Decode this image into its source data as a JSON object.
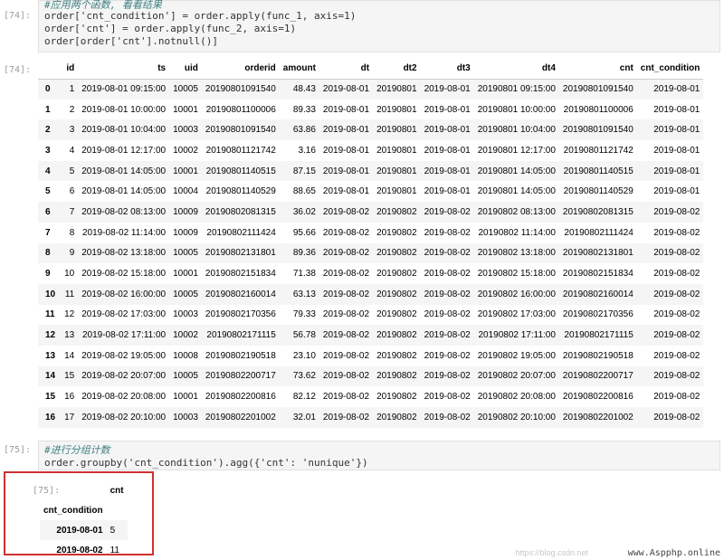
{
  "cell74": {
    "prompt": "[74]:",
    "code": [
      "#应用两个函数, 看看结果",
      "order['cnt_condition'] = order.apply(func_1, axis=1)",
      "order['cnt'] = order.apply(func_2, axis=1)",
      "order[order['cnt'].notnull()]"
    ],
    "out_prompt": "[74]:",
    "columns": [
      "",
      "id",
      "ts",
      "uid",
      "orderid",
      "amount",
      "dt",
      "dt2",
      "dt3",
      "dt4",
      "cnt",
      "cnt_condition"
    ],
    "rows": [
      [
        "0",
        "1",
        "2019-08-01 09:15:00",
        "10005",
        "20190801091540",
        "48.43",
        "2019-08-01",
        "20190801",
        "2019-08-01",
        "20190801 09:15:00",
        "20190801091540",
        "2019-08-01"
      ],
      [
        "1",
        "2",
        "2019-08-01 10:00:00",
        "10001",
        "20190801100006",
        "89.33",
        "2019-08-01",
        "20190801",
        "2019-08-01",
        "20190801 10:00:00",
        "20190801100006",
        "2019-08-01"
      ],
      [
        "2",
        "3",
        "2019-08-01 10:04:00",
        "10003",
        "20190801091540",
        "63.86",
        "2019-08-01",
        "20190801",
        "2019-08-01",
        "20190801 10:04:00",
        "20190801091540",
        "2019-08-01"
      ],
      [
        "3",
        "4",
        "2019-08-01 12:17:00",
        "10002",
        "20190801121742",
        "3.16",
        "2019-08-01",
        "20190801",
        "2019-08-01",
        "20190801 12:17:00",
        "20190801121742",
        "2019-08-01"
      ],
      [
        "4",
        "5",
        "2019-08-01 14:05:00",
        "10001",
        "20190801140515",
        "87.15",
        "2019-08-01",
        "20190801",
        "2019-08-01",
        "20190801 14:05:00",
        "20190801140515",
        "2019-08-01"
      ],
      [
        "5",
        "6",
        "2019-08-01 14:05:00",
        "10004",
        "20190801140529",
        "88.65",
        "2019-08-01",
        "20190801",
        "2019-08-01",
        "20190801 14:05:00",
        "20190801140529",
        "2019-08-01"
      ],
      [
        "6",
        "7",
        "2019-08-02 08:13:00",
        "10009",
        "20190802081315",
        "36.02",
        "2019-08-02",
        "20190802",
        "2019-08-02",
        "20190802 08:13:00",
        "20190802081315",
        "2019-08-02"
      ],
      [
        "7",
        "8",
        "2019-08-02 11:14:00",
        "10009",
        "20190802111424",
        "95.66",
        "2019-08-02",
        "20190802",
        "2019-08-02",
        "20190802 11:14:00",
        "20190802111424",
        "2019-08-02"
      ],
      [
        "8",
        "9",
        "2019-08-02 13:18:00",
        "10005",
        "20190802131801",
        "89.36",
        "2019-08-02",
        "20190802",
        "2019-08-02",
        "20190802 13:18:00",
        "20190802131801",
        "2019-08-02"
      ],
      [
        "9",
        "10",
        "2019-08-02 15:18:00",
        "10001",
        "20190802151834",
        "71.38",
        "2019-08-02",
        "20190802",
        "2019-08-02",
        "20190802 15:18:00",
        "20190802151834",
        "2019-08-02"
      ],
      [
        "10",
        "11",
        "2019-08-02 16:00:00",
        "10005",
        "20190802160014",
        "63.13",
        "2019-08-02",
        "20190802",
        "2019-08-02",
        "20190802 16:00:00",
        "20190802160014",
        "2019-08-02"
      ],
      [
        "11",
        "12",
        "2019-08-02 17:03:00",
        "10003",
        "20190802170356",
        "79.33",
        "2019-08-02",
        "20190802",
        "2019-08-02",
        "20190802 17:03:00",
        "20190802170356",
        "2019-08-02"
      ],
      [
        "12",
        "13",
        "2019-08-02 17:11:00",
        "10002",
        "20190802171115",
        "56.78",
        "2019-08-02",
        "20190802",
        "2019-08-02",
        "20190802 17:11:00",
        "20190802171115",
        "2019-08-02"
      ],
      [
        "13",
        "14",
        "2019-08-02 19:05:00",
        "10008",
        "20190802190518",
        "23.10",
        "2019-08-02",
        "20190802",
        "2019-08-02",
        "20190802 19:05:00",
        "20190802190518",
        "2019-08-02"
      ],
      [
        "14",
        "15",
        "2019-08-02 20:07:00",
        "10005",
        "20190802200717",
        "73.62",
        "2019-08-02",
        "20190802",
        "2019-08-02",
        "20190802 20:07:00",
        "20190802200717",
        "2019-08-02"
      ],
      [
        "15",
        "16",
        "2019-08-02 20:08:00",
        "10001",
        "20190802200816",
        "82.12",
        "2019-08-02",
        "20190802",
        "2019-08-02",
        "20190802 20:08:00",
        "20190802200816",
        "2019-08-02"
      ],
      [
        "16",
        "17",
        "2019-08-02 20:10:00",
        "10003",
        "20190802201002",
        "32.01",
        "2019-08-02",
        "20190802",
        "2019-08-02",
        "20190802 20:10:00",
        "20190802201002",
        "2019-08-02"
      ]
    ]
  },
  "cell75": {
    "prompt": "[75]:",
    "code": [
      "#进行分组计数",
      "order.groupby('cnt_condition').agg({'cnt': 'nunique'})"
    ],
    "out_prompt": "[75]:",
    "col_header": "cnt",
    "index_name": "cnt_condition",
    "rows": [
      [
        "2019-08-01",
        "5"
      ],
      [
        "2019-08-02",
        "11"
      ]
    ],
    "highlight_color": "#d03030"
  },
  "watermark": "www.Aspphp.online",
  "watermark_faint": "https://blog.csdn.net"
}
